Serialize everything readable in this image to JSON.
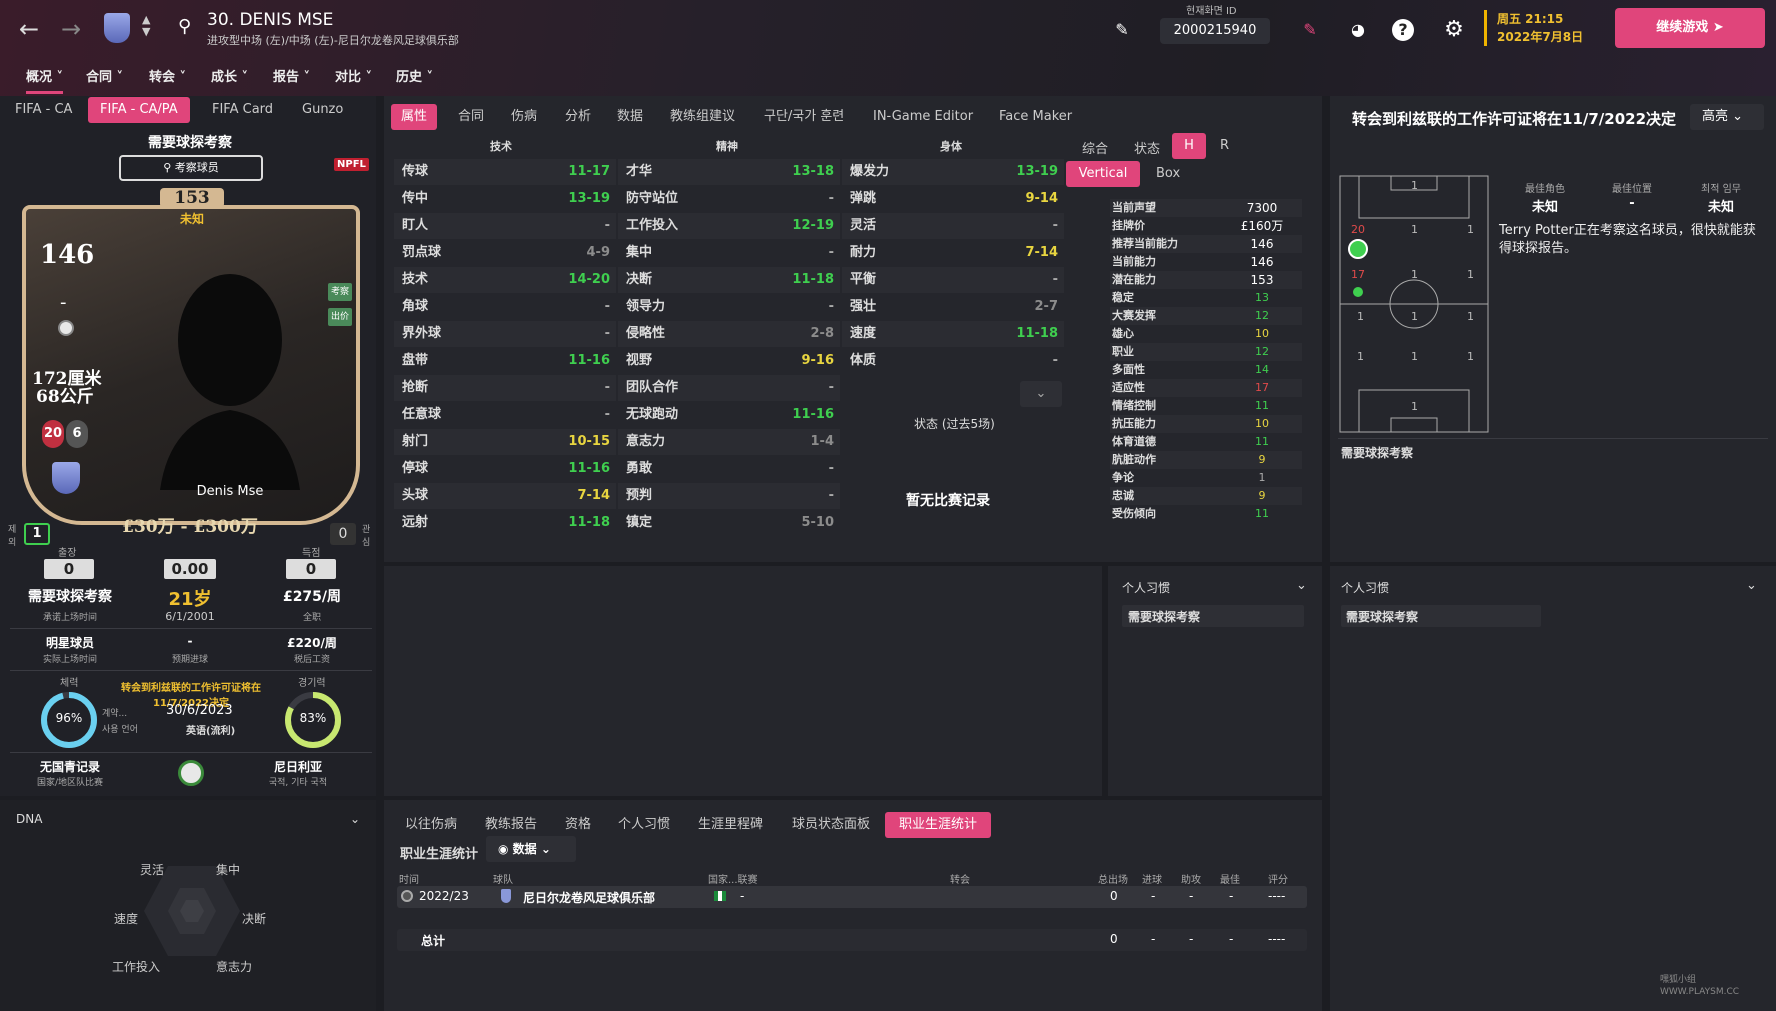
{
  "header": {
    "title": "30. DENIS MSE",
    "subtitle": "进攻型中场 (左)/中场 (左)-尼日尔龙卷风足球俱乐部",
    "nav": [
      "概况",
      "合同",
      "转会",
      "成长",
      "报告",
      "对比",
      "历史"
    ],
    "id_label": "현재화면 ID",
    "id_value": "2000215940",
    "day_time": "周五 21:15",
    "date": "2022年7月8日",
    "continue": "继续游戏"
  },
  "card_tabs": [
    "FIFA - CA",
    "FIFA - CA/PA",
    "FIFA Card",
    "Gunzo"
  ],
  "card": {
    "scout_title": "需要球探考察",
    "scout_btn": "考察球员",
    "pa": "153",
    "pa_label": "未知",
    "ca": "146",
    "dash": "-",
    "height": "172厘米",
    "weight": "68公斤",
    "left_foot": "20",
    "right_foot": "6",
    "tag1": "考察",
    "tag2": "出价",
    "name": "Denis Mse",
    "value": "£30万 - £300万",
    "left_badge": "1",
    "left_badge_label": "제외",
    "right_badge": "0",
    "right_badge_label": "관심",
    "league_logo": "NPFL"
  },
  "stats": {
    "apps_label": "출장",
    "apps": "0",
    "avg": "0.00",
    "goals_label": "득점",
    "goals": "0",
    "status": "需要球探考察",
    "status_sub": "承诺上场时间",
    "age": "21岁",
    "dob": "6/1/2001",
    "wage": "£275/周",
    "wage_sub": "全职",
    "role": "明星球员",
    "role_sub": "实际上场时间",
    "proj": "-",
    "proj_sub": "预期进球",
    "net_wage": "£220/周",
    "net_wage_sub": "税后工资",
    "fitness_label": "체력",
    "fitness": "96%",
    "fitness_value": 96,
    "sharp_label": "경기력",
    "sharp": "83%",
    "sharp_value": 83,
    "permit": "转会到利兹联的工作许可证将在11/7/2022决定",
    "contract_label": "계약...",
    "contract": "30/6/2023",
    "lang_label": "사용 언어",
    "lang": "英语(流利)",
    "youth": "无国青记录",
    "youth_sub": "国家/地区队比赛",
    "nation": "尼日利亚",
    "nation_sub": "국적, 기타 국적"
  },
  "dna": {
    "title": "DNA",
    "labels": [
      "灵活",
      "集中",
      "速度",
      "决断",
      "工作投入",
      "意志力"
    ]
  },
  "attr_tabs": [
    "属性",
    "合同",
    "伤病",
    "分析",
    "数据",
    "教练组建议",
    "구단/국가 훈련",
    "IN-Game Editor",
    "Face Maker"
  ],
  "attr_headers": [
    "技术",
    "精神",
    "身体"
  ],
  "technical": [
    {
      "n": "传球",
      "v": "11-17",
      "c": "g"
    },
    {
      "n": "传中",
      "v": "13-19",
      "c": "g"
    },
    {
      "n": "盯人",
      "v": "-",
      "c": "d"
    },
    {
      "n": "罚点球",
      "v": "4-9",
      "c": "gr"
    },
    {
      "n": "技术",
      "v": "14-20",
      "c": "g"
    },
    {
      "n": "角球",
      "v": "-",
      "c": "d"
    },
    {
      "n": "界外球",
      "v": "-",
      "c": "d"
    },
    {
      "n": "盘带",
      "v": "11-16",
      "c": "g"
    },
    {
      "n": "抢断",
      "v": "-",
      "c": "d"
    },
    {
      "n": "任意球",
      "v": "-",
      "c": "d"
    },
    {
      "n": "射门",
      "v": "10-15",
      "c": "y"
    },
    {
      "n": "停球",
      "v": "11-16",
      "c": "g"
    },
    {
      "n": "头球",
      "v": "7-14",
      "c": "y"
    },
    {
      "n": "远射",
      "v": "11-18",
      "c": "g"
    }
  ],
  "mental": [
    {
      "n": "才华",
      "v": "13-18",
      "c": "g"
    },
    {
      "n": "防守站位",
      "v": "-",
      "c": "d"
    },
    {
      "n": "工作投入",
      "v": "12-19",
      "c": "g"
    },
    {
      "n": "集中",
      "v": "-",
      "c": "d"
    },
    {
      "n": "决断",
      "v": "11-18",
      "c": "g"
    },
    {
      "n": "领导力",
      "v": "-",
      "c": "d"
    },
    {
      "n": "侵略性",
      "v": "2-8",
      "c": "gr"
    },
    {
      "n": "视野",
      "v": "9-16",
      "c": "y"
    },
    {
      "n": "团队合作",
      "v": "-",
      "c": "d"
    },
    {
      "n": "无球跑动",
      "v": "11-16",
      "c": "g"
    },
    {
      "n": "意志力",
      "v": "1-4",
      "c": "gr"
    },
    {
      "n": "勇敢",
      "v": "-",
      "c": "d"
    },
    {
      "n": "预判",
      "v": "-",
      "c": "d"
    },
    {
      "n": "镇定",
      "v": "5-10",
      "c": "gr"
    }
  ],
  "physical": [
    {
      "n": "爆发力",
      "v": "13-19",
      "c": "g"
    },
    {
      "n": "弹跳",
      "v": "9-14",
      "c": "y"
    },
    {
      "n": "灵活",
      "v": "-",
      "c": "d"
    },
    {
      "n": "耐力",
      "v": "7-14",
      "c": "y"
    },
    {
      "n": "平衡",
      "v": "-",
      "c": "d"
    },
    {
      "n": "强壮",
      "v": "2-7",
      "c": "gr"
    },
    {
      "n": "速度",
      "v": "11-18",
      "c": "g"
    },
    {
      "n": "体质",
      "v": "-",
      "c": "d"
    }
  ],
  "form_label": "状态 (过去5场)",
  "no_matches": "暂无比赛记录",
  "view_tabs": [
    "综合",
    "状态",
    "H",
    "R"
  ],
  "layout_tabs": [
    "Vertical",
    "Box"
  ],
  "info": [
    {
      "n": "当前声望",
      "v": "7300",
      "c": ""
    },
    {
      "n": "挂牌价",
      "v": "£160万",
      "c": ""
    },
    {
      "n": "推荐当前能力",
      "v": "146",
      "c": ""
    },
    {
      "n": "当前能力",
      "v": "146",
      "c": ""
    },
    {
      "n": "潜在能力",
      "v": "153",
      "c": ""
    },
    {
      "n": "稳定",
      "v": "13",
      "c": "g"
    },
    {
      "n": "大赛发挥",
      "v": "12",
      "c": "g"
    },
    {
      "n": "雄心",
      "v": "10",
      "c": "y"
    },
    {
      "n": "职业",
      "v": "12",
      "c": "g"
    },
    {
      "n": "多面性",
      "v": "14",
      "c": "g"
    },
    {
      "n": "适应性",
      "v": "17",
      "c": "r"
    },
    {
      "n": "情绪控制",
      "v": "11",
      "c": "g"
    },
    {
      "n": "抗压能力",
      "v": "10",
      "c": "y"
    },
    {
      "n": "体育道德",
      "v": "11",
      "c": "g"
    },
    {
      "n": "肮脏动作",
      "v": "9",
      "c": "y"
    },
    {
      "n": "争论",
      "v": "1",
      "c": "gr"
    },
    {
      "n": "忠诚",
      "v": "9",
      "c": "y"
    },
    {
      "n": "受伤倾向",
      "v": "11",
      "c": "g"
    }
  ],
  "right": {
    "title": "转会到利兹联的工作许可证将在11/7/2022决定",
    "dropdown": "高亮",
    "best_role_label": "最佳角色",
    "best_role": "未知",
    "best_pos_label": "最佳位置",
    "best_pos": "-",
    "best_duty_label": "최적 임무",
    "best_duty": "未知",
    "desc": "Terry Potter正在考察这名球员，很快就能获得球探报告。",
    "pitch_scout": "需要球探考察",
    "pitch_nums": [
      "1",
      "20",
      "1",
      "1",
      "17",
      "1",
      "1",
      "1",
      "1",
      "1",
      "1",
      "1",
      "1",
      "1",
      "1"
    ]
  },
  "habits": {
    "title": "个人习惯",
    "text": "需要球探考察"
  },
  "career": {
    "tabs": [
      "以往伤病",
      "教练报告",
      "资格",
      "个人习惯",
      "生涯里程碑",
      "球员状态面板",
      "职业生涯统计"
    ],
    "label": "职业生涯统计",
    "filter": "数据",
    "cols": [
      "时间",
      "球队",
      "国家...联赛",
      "转会",
      "总出场",
      "进球",
      "助攻",
      "最佳",
      "评分"
    ],
    "row": [
      "2022/23",
      "尼日尔龙卷风足球俱乐部",
      "-",
      "",
      "0",
      "-",
      "-",
      "-",
      "----"
    ],
    "total": [
      "总计",
      "0",
      "-",
      "-",
      "-",
      "----"
    ]
  },
  "watermark": "嘿狐小组 WWW.PLAYSM.CC",
  "colors": {
    "accent": "#e0457b",
    "green": "#3fcf4f",
    "yellow": "#e8d540",
    "red": "#e04a4a",
    "gold": "#f0c030"
  }
}
